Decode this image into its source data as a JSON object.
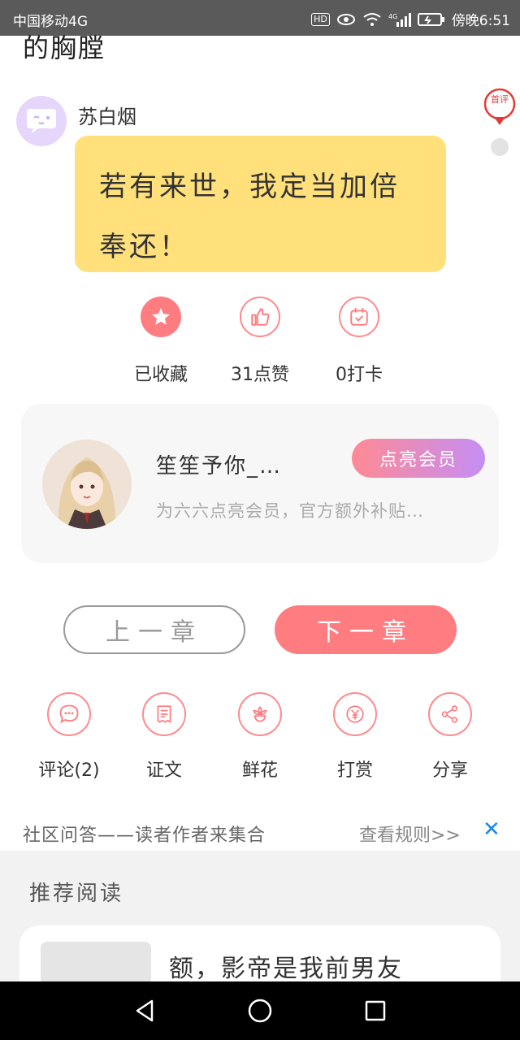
{
  "status_bar": {
    "carrier": "中国移动4G",
    "hd": "HD",
    "network": "4G",
    "time": "傍晚6:51"
  },
  "chapter": {
    "prev_text_fragment": "的胸膛",
    "author_name": "苏白烟",
    "author_note": "若有来世，我定当加倍奉还！",
    "first_badge": "首评"
  },
  "actions": [
    {
      "label": "已收藏",
      "icon": "star-icon"
    },
    {
      "label": "31点赞",
      "icon": "thumbs-up-icon"
    },
    {
      "label": "0打卡",
      "icon": "calendar-check-icon"
    }
  ],
  "member": {
    "name": "笙笙予你_…",
    "button": "点亮会员",
    "description": "为六六点亮会员，官方额外补贴…"
  },
  "navigation": {
    "prev": "上一章",
    "next": "下一章"
  },
  "tools": [
    {
      "label": "评论(2)",
      "icon": "comment-icon"
    },
    {
      "label": "证文",
      "icon": "document-icon"
    },
    {
      "label": "鲜花",
      "icon": "flower-icon"
    },
    {
      "label": "打赏",
      "icon": "yen-icon"
    },
    {
      "label": "分享",
      "icon": "share-icon"
    }
  ],
  "community": {
    "text": "社区问答——读者作者来集合",
    "rule_link": "查看规则>>",
    "close": "✕"
  },
  "recommend": {
    "title": "推荐阅读",
    "book_title": "额，影帝是我前男友"
  },
  "colors": {
    "accent": "#ff7c80",
    "bubble": "#ffe07a",
    "member_gradient_start": "#ff8a94",
    "member_gradient_end": "#c58ef5",
    "close": "#1e88e5"
  }
}
